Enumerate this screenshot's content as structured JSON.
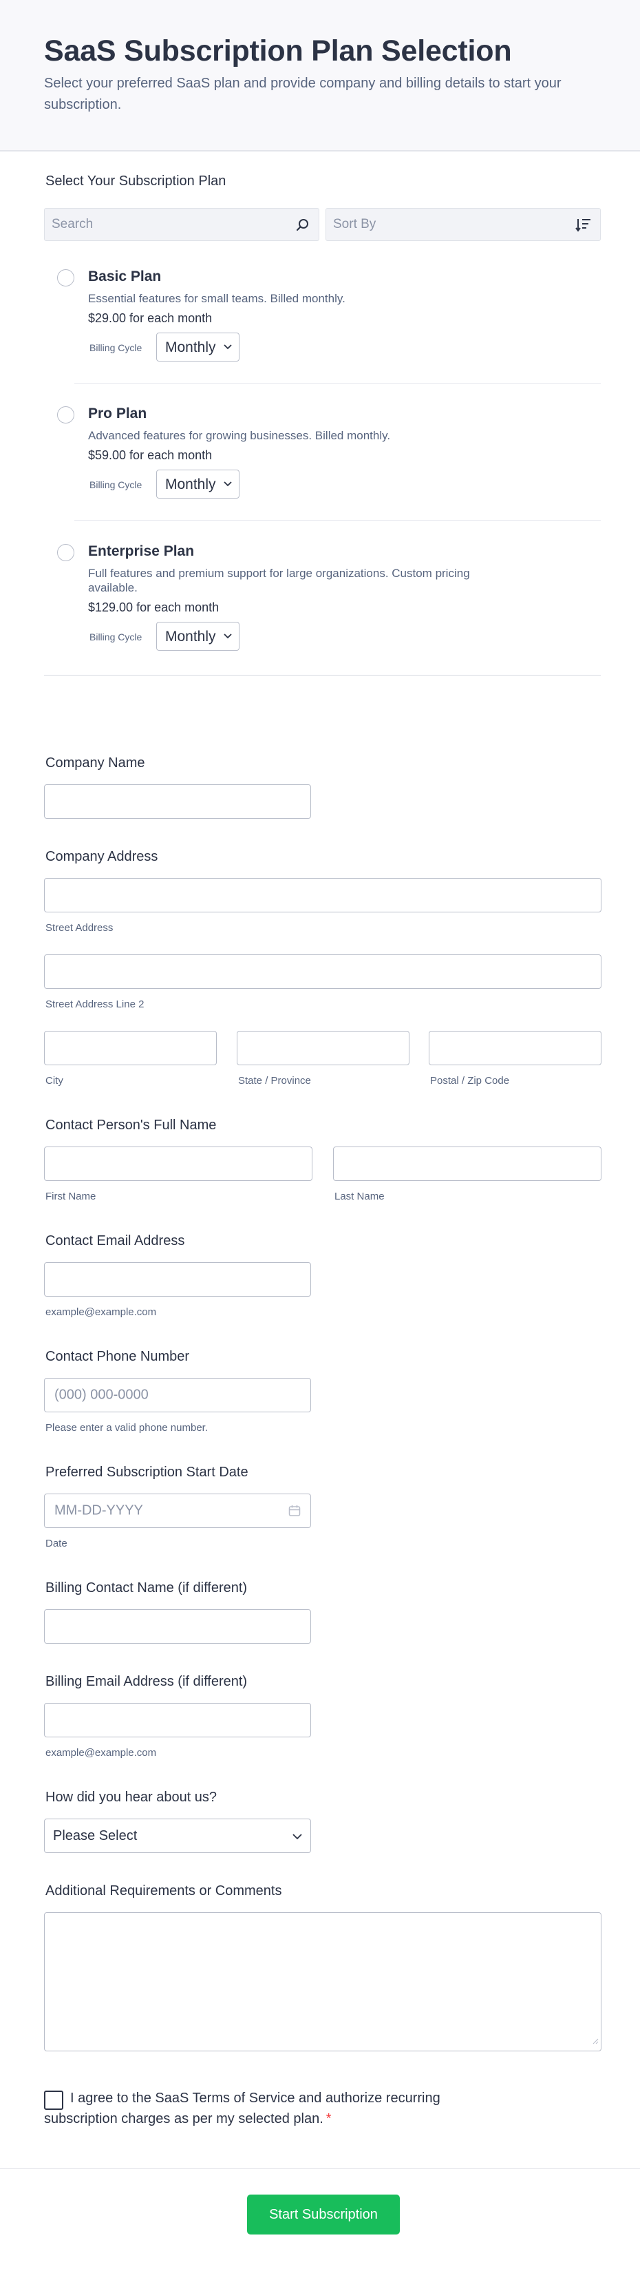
{
  "header": {
    "title": "SaaS Subscription Plan Selection",
    "subtitle": "Select your preferred SaaS plan and provide company and billing details to start your subscription."
  },
  "plans_section": {
    "label": "Select Your Subscription Plan",
    "search_placeholder": "Search",
    "sort_placeholder": "Sort By",
    "billing_cycle_label": "Billing Cycle",
    "plans": [
      {
        "name": "Basic Plan",
        "description": "Essential features for small teams. Billed monthly.",
        "price": "$29.00 for each month",
        "cycle": "Monthly",
        "selected": false
      },
      {
        "name": "Pro Plan",
        "description": "Advanced features for growing businesses. Billed monthly.",
        "price": "$59.00 for each month",
        "cycle": "Monthly",
        "selected": false
      },
      {
        "name": "Enterprise Plan",
        "description": "Full features and premium support for large organizations. Custom pricing available.",
        "price": "$129.00 for each month",
        "cycle": "Monthly",
        "selected": false
      }
    ]
  },
  "company_name": {
    "label": "Company Name",
    "value": ""
  },
  "company_address": {
    "label": "Company Address",
    "street_sublabel": "Street Address",
    "street2_sublabel": "Street Address Line 2",
    "city_sublabel": "City",
    "state_sublabel": "State / Province",
    "zip_sublabel": "Postal / Zip Code"
  },
  "contact_name": {
    "label": "Contact Person's Full Name",
    "first_sublabel": "First Name",
    "last_sublabel": "Last Name"
  },
  "contact_email": {
    "label": "Contact Email Address",
    "sublabel": "example@example.com"
  },
  "contact_phone": {
    "label": "Contact Phone Number",
    "placeholder": "(000) 000-0000",
    "sublabel": "Please enter a valid phone number."
  },
  "start_date": {
    "label": "Preferred Subscription Start Date",
    "placeholder": "MM-DD-YYYY",
    "sublabel": "Date"
  },
  "billing_name": {
    "label": "Billing Contact Name (if different)"
  },
  "billing_email": {
    "label": "Billing Email Address (if different)",
    "sublabel": "example@example.com"
  },
  "referral": {
    "label": "How did you hear about us?",
    "selected": "Please Select"
  },
  "comments": {
    "label": "Additional Requirements or Comments"
  },
  "terms": {
    "text": "I agree to the SaaS Terms of Service and authorize recurring subscription charges as per my selected plan.",
    "required_mark": "*"
  },
  "submit": {
    "label": "Start Subscription"
  },
  "colors": {
    "accent": "#18bd5b",
    "required": "#f23a3c",
    "text": "#2c3345",
    "muted": "#57647e"
  }
}
